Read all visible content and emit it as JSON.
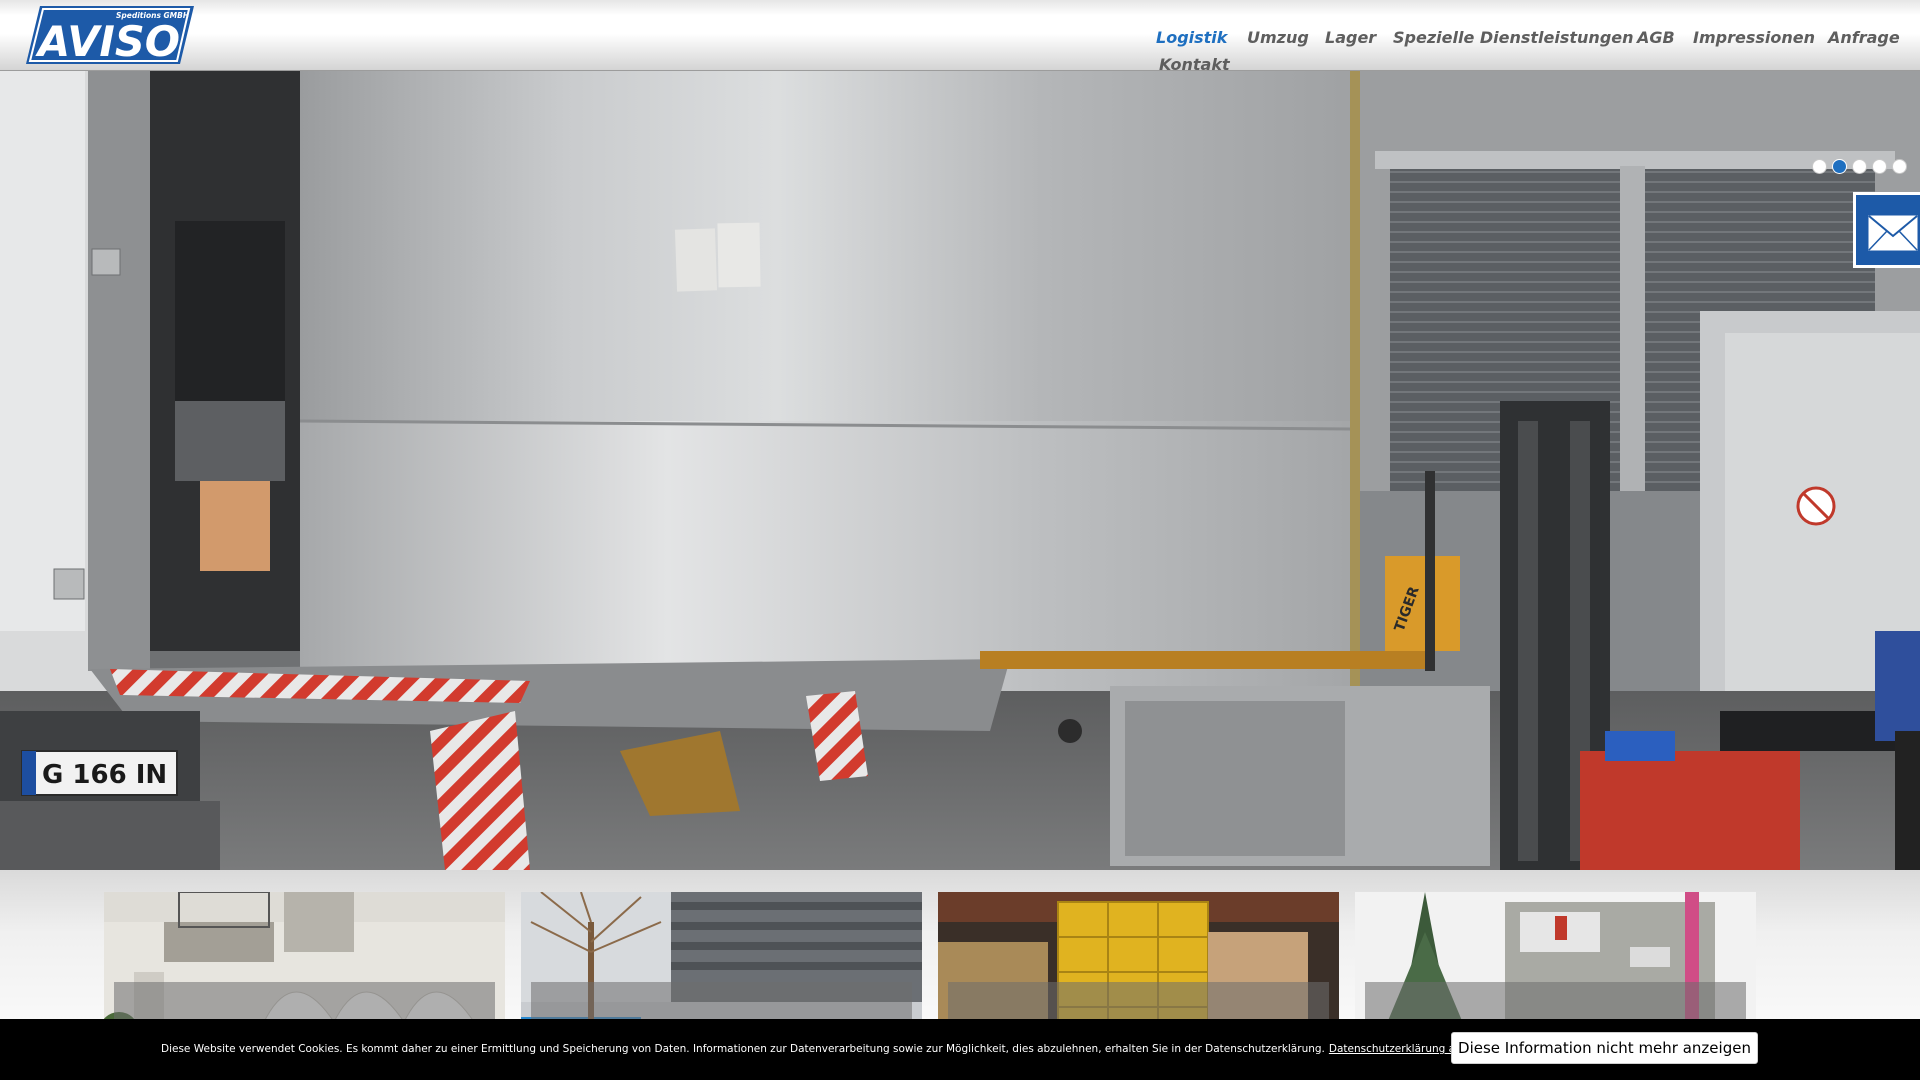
{
  "logo": {
    "text": "AVISO",
    "subtitle": "Speditions GMBH",
    "brand_color": "#1d5aa8"
  },
  "nav": {
    "items": [
      {
        "label": "Logistik",
        "active": true
      },
      {
        "label": "Umzug"
      },
      {
        "label": "Lager"
      },
      {
        "label": "Spezielle Dienstleistungen"
      },
      {
        "label": "AGB"
      },
      {
        "label": "Impressionen"
      },
      {
        "label": "Anfrage"
      },
      {
        "label": "Kontakt"
      }
    ],
    "active_color": "#1e6fc0",
    "color": "#5e5e5e"
  },
  "hero": {
    "slides_total": 5,
    "active_slide": 2,
    "plate_text": "G 166 IN",
    "lift_brand": "TIGER",
    "image": "truck-loading-dock-photo"
  },
  "contact_tab": {
    "icon": "mail-icon"
  },
  "tiles": [
    {
      "image": "building-courtyard-photo"
    },
    {
      "image": "office-building-photo"
    },
    {
      "image": "warehouse-pallets-photo"
    },
    {
      "image": "crane-lift-photo"
    }
  ],
  "cookie": {
    "text": "Diese Website verwendet Cookies. Es kommt daher zu einer Ermittlung und Speicherung von Daten. Informationen zur Datenverarbeitung sowie zur Möglichkeit, dies abzulehnen, erhalten Sie in der Datenschutzerklärung.",
    "link": "Datenschutzerklärung anzeigen",
    "button": "Diese Information nicht mehr anzeigen"
  }
}
